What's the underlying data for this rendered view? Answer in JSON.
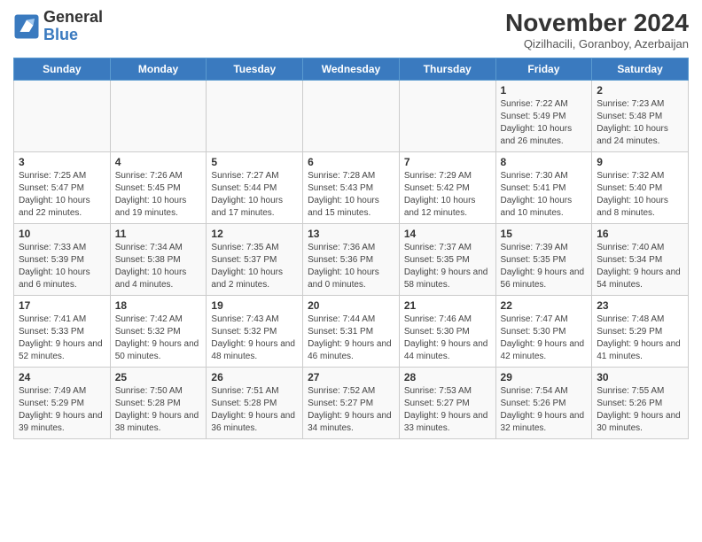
{
  "header": {
    "logo_line1": "General",
    "logo_line2": "Blue",
    "month_title": "November 2024",
    "location": "Qizilhacili, Goranboy, Azerbaijan"
  },
  "days_of_week": [
    "Sunday",
    "Monday",
    "Tuesday",
    "Wednesday",
    "Thursday",
    "Friday",
    "Saturday"
  ],
  "weeks": [
    [
      {
        "day": "",
        "info": ""
      },
      {
        "day": "",
        "info": ""
      },
      {
        "day": "",
        "info": ""
      },
      {
        "day": "",
        "info": ""
      },
      {
        "day": "",
        "info": ""
      },
      {
        "day": "1",
        "info": "Sunrise: 7:22 AM\nSunset: 5:49 PM\nDaylight: 10 hours and 26 minutes."
      },
      {
        "day": "2",
        "info": "Sunrise: 7:23 AM\nSunset: 5:48 PM\nDaylight: 10 hours and 24 minutes."
      }
    ],
    [
      {
        "day": "3",
        "info": "Sunrise: 7:25 AM\nSunset: 5:47 PM\nDaylight: 10 hours and 22 minutes."
      },
      {
        "day": "4",
        "info": "Sunrise: 7:26 AM\nSunset: 5:45 PM\nDaylight: 10 hours and 19 minutes."
      },
      {
        "day": "5",
        "info": "Sunrise: 7:27 AM\nSunset: 5:44 PM\nDaylight: 10 hours and 17 minutes."
      },
      {
        "day": "6",
        "info": "Sunrise: 7:28 AM\nSunset: 5:43 PM\nDaylight: 10 hours and 15 minutes."
      },
      {
        "day": "7",
        "info": "Sunrise: 7:29 AM\nSunset: 5:42 PM\nDaylight: 10 hours and 12 minutes."
      },
      {
        "day": "8",
        "info": "Sunrise: 7:30 AM\nSunset: 5:41 PM\nDaylight: 10 hours and 10 minutes."
      },
      {
        "day": "9",
        "info": "Sunrise: 7:32 AM\nSunset: 5:40 PM\nDaylight: 10 hours and 8 minutes."
      }
    ],
    [
      {
        "day": "10",
        "info": "Sunrise: 7:33 AM\nSunset: 5:39 PM\nDaylight: 10 hours and 6 minutes."
      },
      {
        "day": "11",
        "info": "Sunrise: 7:34 AM\nSunset: 5:38 PM\nDaylight: 10 hours and 4 minutes."
      },
      {
        "day": "12",
        "info": "Sunrise: 7:35 AM\nSunset: 5:37 PM\nDaylight: 10 hours and 2 minutes."
      },
      {
        "day": "13",
        "info": "Sunrise: 7:36 AM\nSunset: 5:36 PM\nDaylight: 10 hours and 0 minutes."
      },
      {
        "day": "14",
        "info": "Sunrise: 7:37 AM\nSunset: 5:35 PM\nDaylight: 9 hours and 58 minutes."
      },
      {
        "day": "15",
        "info": "Sunrise: 7:39 AM\nSunset: 5:35 PM\nDaylight: 9 hours and 56 minutes."
      },
      {
        "day": "16",
        "info": "Sunrise: 7:40 AM\nSunset: 5:34 PM\nDaylight: 9 hours and 54 minutes."
      }
    ],
    [
      {
        "day": "17",
        "info": "Sunrise: 7:41 AM\nSunset: 5:33 PM\nDaylight: 9 hours and 52 minutes."
      },
      {
        "day": "18",
        "info": "Sunrise: 7:42 AM\nSunset: 5:32 PM\nDaylight: 9 hours and 50 minutes."
      },
      {
        "day": "19",
        "info": "Sunrise: 7:43 AM\nSunset: 5:32 PM\nDaylight: 9 hours and 48 minutes."
      },
      {
        "day": "20",
        "info": "Sunrise: 7:44 AM\nSunset: 5:31 PM\nDaylight: 9 hours and 46 minutes."
      },
      {
        "day": "21",
        "info": "Sunrise: 7:46 AM\nSunset: 5:30 PM\nDaylight: 9 hours and 44 minutes."
      },
      {
        "day": "22",
        "info": "Sunrise: 7:47 AM\nSunset: 5:30 PM\nDaylight: 9 hours and 42 minutes."
      },
      {
        "day": "23",
        "info": "Sunrise: 7:48 AM\nSunset: 5:29 PM\nDaylight: 9 hours and 41 minutes."
      }
    ],
    [
      {
        "day": "24",
        "info": "Sunrise: 7:49 AM\nSunset: 5:29 PM\nDaylight: 9 hours and 39 minutes."
      },
      {
        "day": "25",
        "info": "Sunrise: 7:50 AM\nSunset: 5:28 PM\nDaylight: 9 hours and 38 minutes."
      },
      {
        "day": "26",
        "info": "Sunrise: 7:51 AM\nSunset: 5:28 PM\nDaylight: 9 hours and 36 minutes."
      },
      {
        "day": "27",
        "info": "Sunrise: 7:52 AM\nSunset: 5:27 PM\nDaylight: 9 hours and 34 minutes."
      },
      {
        "day": "28",
        "info": "Sunrise: 7:53 AM\nSunset: 5:27 PM\nDaylight: 9 hours and 33 minutes."
      },
      {
        "day": "29",
        "info": "Sunrise: 7:54 AM\nSunset: 5:26 PM\nDaylight: 9 hours and 32 minutes."
      },
      {
        "day": "30",
        "info": "Sunrise: 7:55 AM\nSunset: 5:26 PM\nDaylight: 9 hours and 30 minutes."
      }
    ]
  ]
}
